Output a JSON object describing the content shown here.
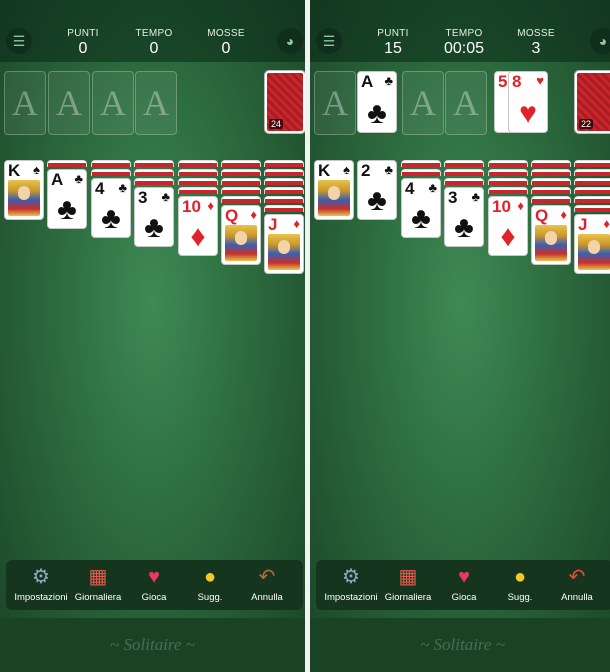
{
  "screens": [
    {
      "stats": [
        {
          "label": "PUNTI",
          "value": "0"
        },
        {
          "label": "TEMPO",
          "value": "0"
        },
        {
          "label": "MOSSE",
          "value": "0"
        }
      ],
      "foundation_placeholder": "A",
      "foundation_placeholder_count": 4,
      "stock_count": "24",
      "waste": [],
      "foundation_cards": []
    },
    {
      "stats": [
        {
          "label": "PUNTI",
          "value": "15"
        },
        {
          "label": "TEMPO",
          "value": "00:05"
        },
        {
          "label": "MOSSE",
          "value": "3"
        }
      ],
      "foundation_placeholder": "A",
      "foundation_placeholder_count": 3,
      "stock_count": "22",
      "waste": [
        {
          "rank": "5",
          "suit": "♥",
          "color": "red"
        },
        {
          "rank": "8",
          "suit": "♥",
          "color": "red"
        }
      ],
      "foundation_cards": [
        {
          "rank": "A",
          "suit": "♣",
          "color": "black"
        }
      ]
    }
  ],
  "tableau": {
    "left": [
      {
        "hidden": 0,
        "top": {
          "rank": "K",
          "suit": "♠",
          "color": "black",
          "face": true
        }
      },
      {
        "hidden": 1,
        "top": {
          "rank": "A",
          "suit": "♣",
          "color": "black",
          "face": false
        }
      },
      {
        "hidden": 2,
        "top": {
          "rank": "4",
          "suit": "♣",
          "color": "black",
          "face": false
        }
      },
      {
        "hidden": 3,
        "top": {
          "rank": "3",
          "suit": "♣",
          "color": "black",
          "face": false
        }
      },
      {
        "hidden": 4,
        "top": {
          "rank": "10",
          "suit": "♦",
          "color": "red",
          "face": false
        }
      },
      {
        "hidden": 5,
        "top": {
          "rank": "Q",
          "suit": "♦",
          "color": "red",
          "face": true
        }
      },
      {
        "hidden": 6,
        "top": {
          "rank": "J",
          "suit": "♦",
          "color": "red",
          "face": true
        }
      }
    ],
    "right": [
      {
        "hidden": 0,
        "top": {
          "rank": "K",
          "suit": "♠",
          "color": "black",
          "face": true
        }
      },
      {
        "hidden": 0,
        "top": {
          "rank": "2",
          "suit": "♣",
          "color": "black",
          "face": false
        }
      },
      {
        "hidden": 2,
        "top": {
          "rank": "4",
          "suit": "♣",
          "color": "black",
          "face": false
        }
      },
      {
        "hidden": 3,
        "top": {
          "rank": "3",
          "suit": "♣",
          "color": "black",
          "face": false
        }
      },
      {
        "hidden": 4,
        "top": {
          "rank": "10",
          "suit": "♦",
          "color": "red",
          "face": false
        }
      },
      {
        "hidden": 5,
        "top": {
          "rank": "Q",
          "suit": "♦",
          "color": "red",
          "face": true
        }
      },
      {
        "hidden": 6,
        "top": {
          "rank": "J",
          "suit": "♦",
          "color": "red",
          "face": true
        }
      }
    ]
  },
  "bottom_nav": [
    {
      "label": "Impostazioni",
      "icon": "gear-icon"
    },
    {
      "label": "Giornaliera",
      "icon": "calendar-icon"
    },
    {
      "label": "Gioca",
      "icon": "cards-icon"
    },
    {
      "label": "Sugg.",
      "icon": "lightbulb-icon"
    },
    {
      "label": "Annulla",
      "icon": "undo-icon"
    }
  ],
  "brand": "~ Solitaire ~",
  "colors": {
    "felt": "#2e6e40",
    "card_red": "#e0232b",
    "card_back": "#c7262c",
    "bar": "#16351f"
  }
}
